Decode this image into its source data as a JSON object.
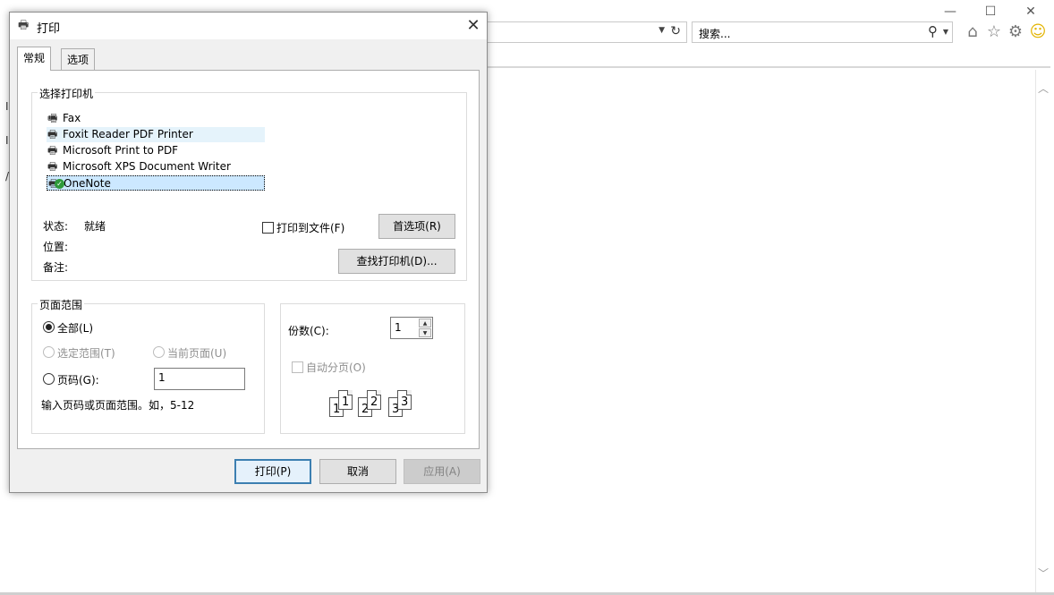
{
  "browser": {
    "window_controls": {
      "minimize": "—",
      "maximize": "☐",
      "close": "✕"
    },
    "search": {
      "placeholder": "搜索..."
    },
    "left_fragments": [
      "I",
      "I",
      "/"
    ]
  },
  "dialog": {
    "title": "打印",
    "tabs": [
      {
        "label": "常规",
        "active": true
      },
      {
        "label": "选项",
        "active": false
      }
    ],
    "printer_group": {
      "label": "选择打印机",
      "printers": [
        {
          "name": "Fax",
          "state": "normal"
        },
        {
          "name": "Foxit Reader PDF Printer",
          "state": "hover"
        },
        {
          "name": "Microsoft Print to PDF",
          "state": "normal"
        },
        {
          "name": "Microsoft XPS Document Writer",
          "state": "normal"
        },
        {
          "name": "OneNote",
          "state": "selected"
        }
      ],
      "status_label": "状态:",
      "status_value": "就绪",
      "location_label": "位置:",
      "comment_label": "备注:",
      "print_to_file_label": "打印到文件(F)",
      "print_to_file_checked": false,
      "preferences_button": "首选项(R)",
      "find_printer_button": "查找打印机(D)..."
    },
    "page_range": {
      "label": "页面范围",
      "all_label": "全部(L)",
      "selection_label": "选定范围(T)",
      "current_page_label": "当前页面(U)",
      "pages_label": "页码(G):",
      "pages_value": "1",
      "hint": "输入页码或页面范围。如，5-12",
      "selected": "all"
    },
    "copies": {
      "label": "份数(C):",
      "value": "1",
      "collate_label": "自动分页(O)",
      "collate_checked": false,
      "collate_pages": [
        "1",
        "1",
        "2",
        "2",
        "3",
        "3"
      ]
    },
    "buttons": {
      "print": "打印(P)",
      "cancel": "取消",
      "apply": "应用(A)"
    }
  }
}
